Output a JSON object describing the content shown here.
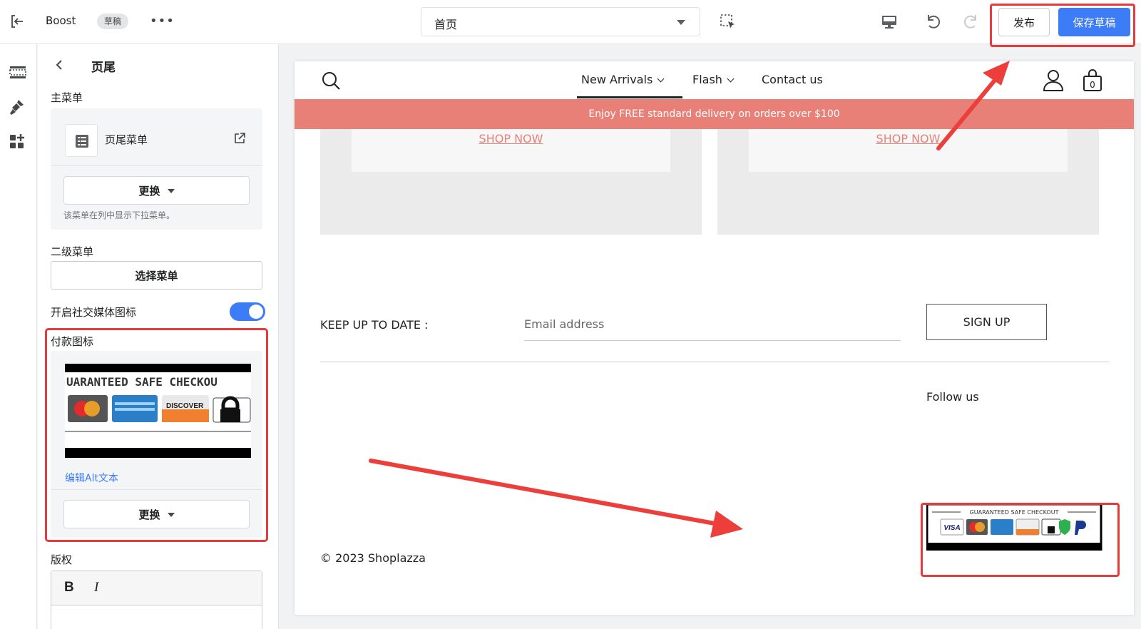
{
  "topbar": {
    "app_name": "Boost",
    "status_badge": "草稿",
    "more_label": "•••",
    "page_select_value": "首页",
    "publish_label": "发布",
    "save_draft_label": "保存草稿"
  },
  "rail": {
    "items": [
      "sections-icon",
      "theme-settings-icon",
      "apps-icon"
    ]
  },
  "panel": {
    "title": "页尾",
    "main_menu": {
      "label": "主菜单",
      "menu_name": "页尾菜单",
      "replace_label": "更换",
      "help": "该菜单在列中显示下拉菜单。"
    },
    "secondary_menu": {
      "label": "二级菜单",
      "select_label": "选择菜单"
    },
    "social_toggle": {
      "label": "开启社交媒体图标",
      "enabled": true
    },
    "payment_icons": {
      "label": "付款图标",
      "image_text": "UARANTEED SAFE CHECKOU",
      "edit_alt_label": "编辑Alt文本",
      "replace_label": "更换"
    },
    "copyright": {
      "label": "版权",
      "bold_label": "B",
      "italic_label": "I"
    }
  },
  "preview": {
    "nav": [
      {
        "label": "New Arrivals",
        "has_dropdown": true,
        "active": true
      },
      {
        "label": "Flash",
        "has_dropdown": true,
        "active": false
      },
      {
        "label": "Contact us",
        "has_dropdown": false,
        "active": false
      }
    ],
    "cart_count": "0",
    "announcement": "Enjoy FREE standard delivery on orders over $100",
    "promo_links": [
      "SHOP NOW",
      "SHOP NOW"
    ],
    "newsletter": {
      "heading": "KEEP UP TO DATE :",
      "email_placeholder": "Email address",
      "signup_label": "SIGN UP"
    },
    "follow_label": "Follow us",
    "copyright": "© 2023 Shoplazza",
    "payment_badge_text": "GUARANTEED SAFE CHECKOUT"
  },
  "colors": {
    "accent": "#3d7cf7",
    "announcement_bg": "#e88078",
    "highlight": "#e8393b"
  }
}
